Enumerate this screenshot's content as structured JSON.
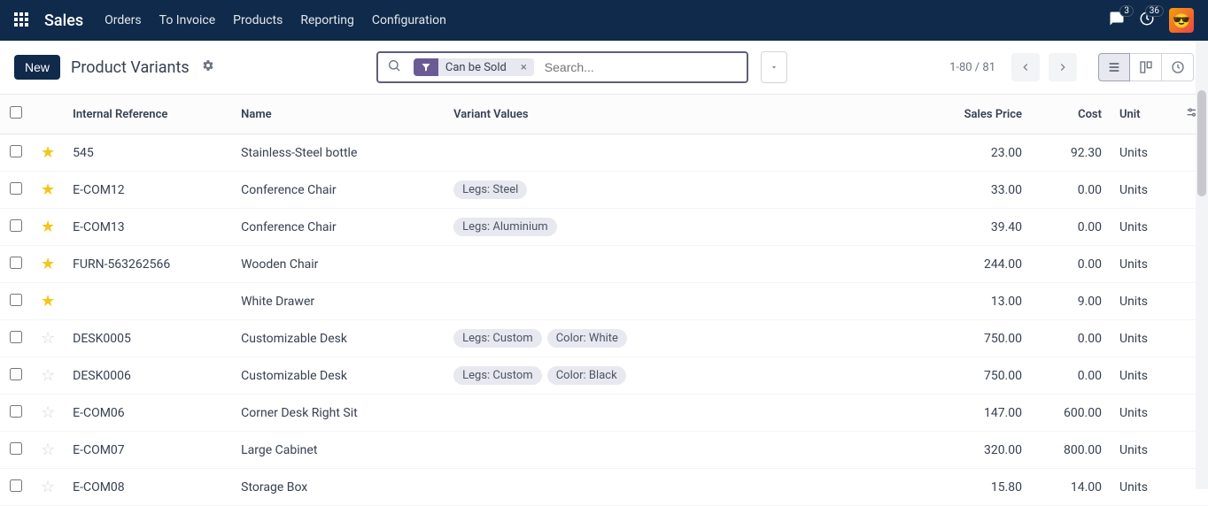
{
  "nav": {
    "brand": "Sales",
    "items": [
      "Orders",
      "To Invoice",
      "Products",
      "Reporting",
      "Configuration"
    ],
    "messages_badge": "3",
    "activities_badge": "36"
  },
  "control": {
    "new_label": "New",
    "title": "Product Variants",
    "filter_chip": "Can be Sold",
    "search_placeholder": "Search...",
    "pager": "1-80 / 81"
  },
  "table": {
    "headers": {
      "ref": "Internal Reference",
      "name": "Name",
      "variants": "Variant Values",
      "price": "Sales Price",
      "cost": "Cost",
      "unit": "Unit"
    },
    "rows": [
      {
        "fav": true,
        "ref": "545",
        "name": "Stainless-Steel bottle",
        "tags": [],
        "price": "23.00",
        "cost": "92.30",
        "unit": "Units"
      },
      {
        "fav": true,
        "ref": "E-COM12",
        "name": "Conference Chair",
        "tags": [
          "Legs: Steel"
        ],
        "price": "33.00",
        "cost": "0.00",
        "unit": "Units"
      },
      {
        "fav": true,
        "ref": "E-COM13",
        "name": "Conference Chair",
        "tags": [
          "Legs: Aluminium"
        ],
        "price": "39.40",
        "cost": "0.00",
        "unit": "Units"
      },
      {
        "fav": true,
        "ref": "FURN-563262566",
        "name": "Wooden Chair",
        "tags": [],
        "price": "244.00",
        "cost": "0.00",
        "unit": "Units"
      },
      {
        "fav": true,
        "ref": "",
        "name": "White Drawer",
        "tags": [],
        "price": "13.00",
        "cost": "9.00",
        "unit": "Units"
      },
      {
        "fav": false,
        "ref": "DESK0005",
        "name": "Customizable Desk",
        "tags": [
          "Legs: Custom",
          "Color: White"
        ],
        "price": "750.00",
        "cost": "0.00",
        "unit": "Units"
      },
      {
        "fav": false,
        "ref": "DESK0006",
        "name": "Customizable Desk",
        "tags": [
          "Legs: Custom",
          "Color: Black"
        ],
        "price": "750.00",
        "cost": "0.00",
        "unit": "Units"
      },
      {
        "fav": false,
        "ref": "E-COM06",
        "name": "Corner Desk Right Sit",
        "tags": [],
        "price": "147.00",
        "cost": "600.00",
        "unit": "Units"
      },
      {
        "fav": false,
        "ref": "E-COM07",
        "name": "Large Cabinet",
        "tags": [],
        "price": "320.00",
        "cost": "800.00",
        "unit": "Units"
      },
      {
        "fav": false,
        "ref": "E-COM08",
        "name": "Storage Box",
        "tags": [],
        "price": "15.80",
        "cost": "14.00",
        "unit": "Units"
      }
    ]
  }
}
